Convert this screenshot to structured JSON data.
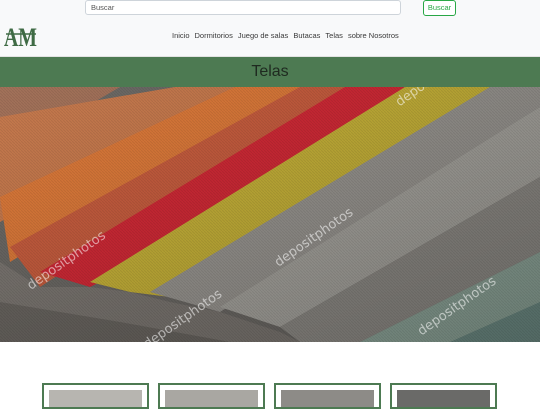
{
  "search": {
    "placeholder": "Buscar",
    "button_label": "Buscar"
  },
  "logo": {
    "text": "AM"
  },
  "nav": {
    "items": [
      "Inicio",
      "Dormitorios",
      "Juego de salas",
      "Butacas",
      "Telas",
      "sobre Nosotros"
    ]
  },
  "page": {
    "title": "Telas"
  },
  "hero": {
    "watermark": "depositphotos",
    "alt_icons": [
      "fabric-swatches-image"
    ]
  },
  "colors": {
    "accent": "#4d7a52",
    "button": "#28a745"
  }
}
